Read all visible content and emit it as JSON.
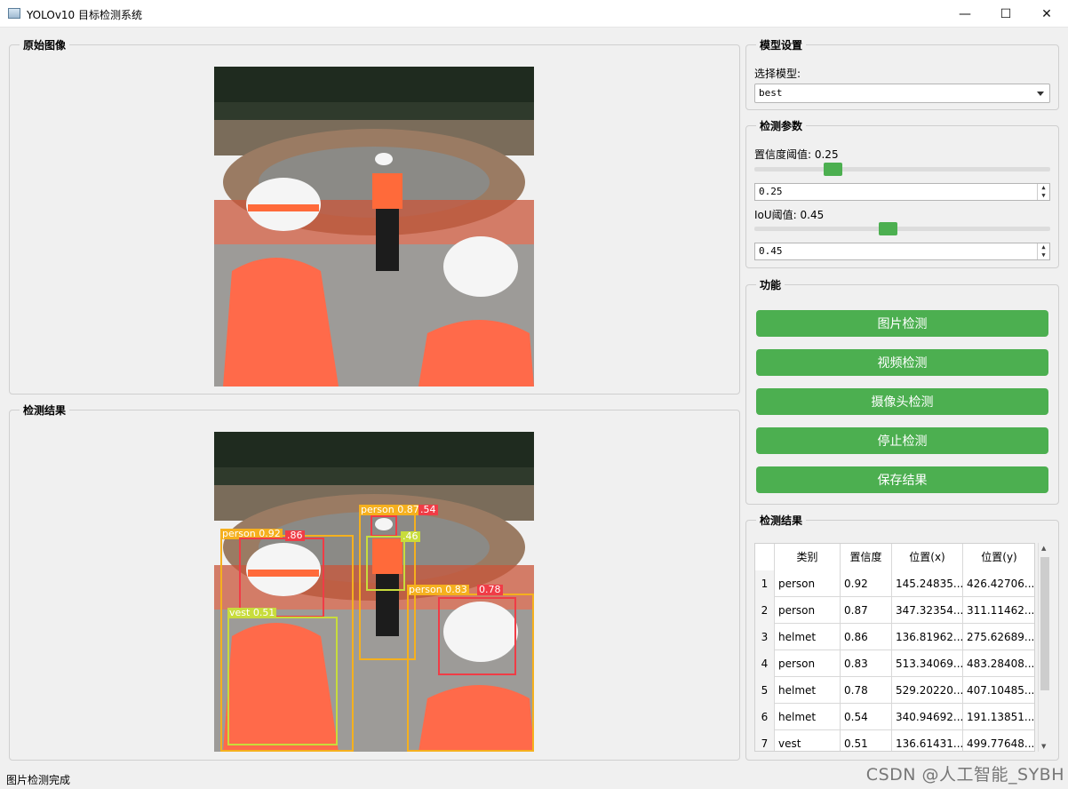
{
  "window": {
    "title": "YOLOv10 目标检测系统",
    "minimize": "—",
    "maximize": "☐",
    "close": "✕"
  },
  "original": {
    "title": "原始图像"
  },
  "result": {
    "title": "检测结果"
  },
  "model": {
    "title": "模型设置",
    "select_label": "选择模型:",
    "selected": "best"
  },
  "params": {
    "title": "检测参数",
    "conf_label": "置信度阈值: 0.25",
    "conf_value": "0.25",
    "conf_fraction": 0.25,
    "iou_label": "IoU阈值: 0.45",
    "iou_value": "0.45",
    "iou_fraction": 0.45
  },
  "functions": {
    "title": "功能",
    "buttons": [
      "图片检测",
      "视频检测",
      "摄像头检测",
      "停止检测",
      "保存结果"
    ]
  },
  "table": {
    "title": "检测结果",
    "headers": [
      "类别",
      "置信度",
      "位置(x)",
      "位置(y)"
    ],
    "rows": [
      [
        "1",
        "person",
        "0.92",
        "145.24835...",
        "426.42706..."
      ],
      [
        "2",
        "person",
        "0.87",
        "347.32354...",
        "311.11462..."
      ],
      [
        "3",
        "helmet",
        "0.86",
        "136.81962...",
        "275.62689..."
      ],
      [
        "4",
        "person",
        "0.83",
        "513.34069...",
        "483.28408..."
      ],
      [
        "5",
        "helmet",
        "0.78",
        "529.20220...",
        "407.10485..."
      ],
      [
        "6",
        "helmet",
        "0.54",
        "340.94692...",
        "191.13851..."
      ],
      [
        "7",
        "vest",
        "0.51",
        "136.61431...",
        "499.77648..."
      ]
    ]
  },
  "detections": [
    {
      "text": "person 0.92",
      "color": "#f5b01e"
    },
    {
      "text": ".86",
      "color": "#f03c46"
    },
    {
      "text": "person 0.87",
      "color": "#f5b01e"
    },
    {
      "text": ".54",
      "color": "#f03c46"
    },
    {
      "text": ".46",
      "color": "#c8dc3c"
    },
    {
      "text": "person 0.83",
      "color": "#f5b01e"
    },
    {
      "text": "0.78",
      "color": "#f03c46"
    },
    {
      "text": "vest 0.51",
      "color": "#c8dc3c"
    }
  ],
  "status": "图片检测完成",
  "watermark": "CSDN @人工智能_SYBH",
  "colors": {
    "accent": "#4caf50",
    "person": "#f5b01e",
    "helmet": "#f03c46",
    "vest": "#c8dc3c"
  }
}
